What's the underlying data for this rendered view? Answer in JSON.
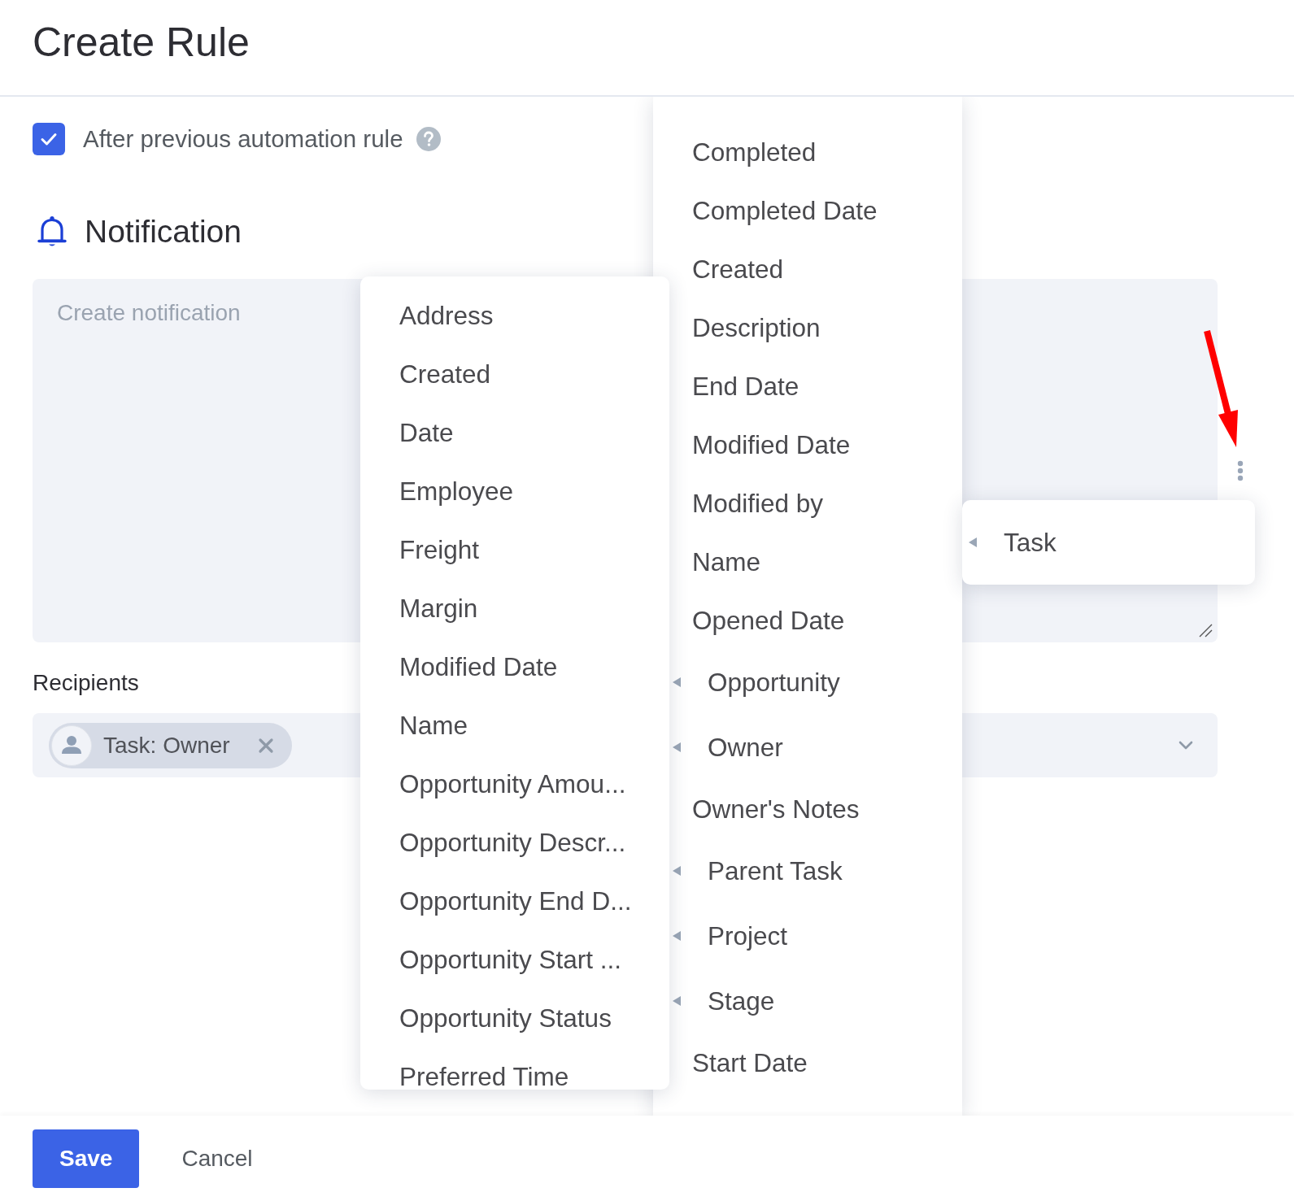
{
  "page": {
    "title": "Create Rule"
  },
  "after_previous": {
    "label": "After previous automation rule",
    "checked": true
  },
  "notification": {
    "heading": "Notification",
    "placeholder": "Create notification"
  },
  "recipients": {
    "label": "Recipients",
    "chips": [
      {
        "label": "Task: Owner"
      }
    ]
  },
  "menus": [
    {
      "items": [
        {
          "label": "Address",
          "kind": "field"
        },
        {
          "label": "Created",
          "kind": "field"
        },
        {
          "label": "Date",
          "kind": "field"
        },
        {
          "label": "Employee",
          "kind": "field"
        },
        {
          "label": "Freight",
          "kind": "field"
        },
        {
          "label": "Margin",
          "kind": "field"
        },
        {
          "label": "Modified Date",
          "kind": "field"
        },
        {
          "label": "Name",
          "kind": "field"
        },
        {
          "label": "Opportunity Amou...",
          "kind": "field"
        },
        {
          "label": "Opportunity Descr...",
          "kind": "field"
        },
        {
          "label": "Opportunity End D...",
          "kind": "field"
        },
        {
          "label": "Opportunity Start ...",
          "kind": "field"
        },
        {
          "label": "Opportunity Status",
          "kind": "field"
        },
        {
          "label": "Preferred Time",
          "kind": "field"
        }
      ]
    },
    {
      "items": [
        {
          "label": "Completed",
          "kind": "field"
        },
        {
          "label": "Completed Date",
          "kind": "field"
        },
        {
          "label": "Created",
          "kind": "field"
        },
        {
          "label": "Description",
          "kind": "field"
        },
        {
          "label": "End Date",
          "kind": "field"
        },
        {
          "label": "Modified Date",
          "kind": "field"
        },
        {
          "label": "Modified by",
          "kind": "field"
        },
        {
          "label": "Name",
          "kind": "field"
        },
        {
          "label": "Opened Date",
          "kind": "field"
        },
        {
          "label": "Opportunity",
          "kind": "submenu"
        },
        {
          "label": "Owner",
          "kind": "submenu"
        },
        {
          "label": "Owner's Notes",
          "kind": "field"
        },
        {
          "label": "Parent Task",
          "kind": "submenu"
        },
        {
          "label": "Project",
          "kind": "submenu"
        },
        {
          "label": "Stage",
          "kind": "submenu"
        },
        {
          "label": "Start Date",
          "kind": "field"
        }
      ]
    },
    {
      "items": [
        {
          "label": "Task",
          "kind": "submenu"
        }
      ]
    }
  ],
  "buttons": [
    {
      "label": "Save",
      "kind": "primary"
    },
    {
      "label": "Cancel",
      "kind": "secondary"
    }
  ]
}
